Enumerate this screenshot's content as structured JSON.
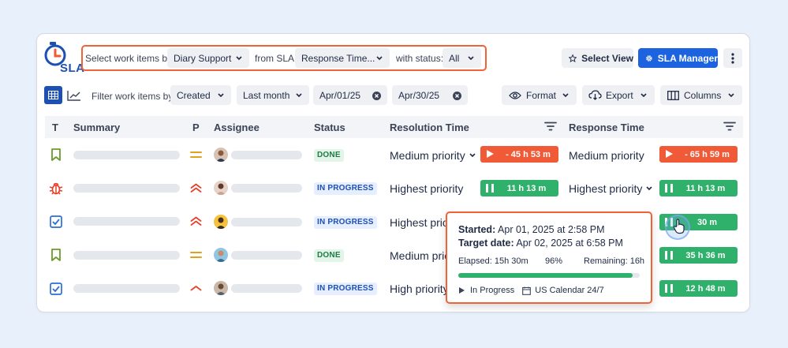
{
  "app": {
    "logo_text": "SLA"
  },
  "toolbar": {
    "select_label": "Select work items by:",
    "project_value": "Diary Support",
    "from_sla_label": "from SLA:",
    "sla_value": "Response Time...",
    "with_status_label": "with status:",
    "status_value": "All",
    "select_view_label": "Select View",
    "sla_manager_label": "SLA Manager"
  },
  "filters": {
    "label": "Filter work items by:",
    "field_value": "Created",
    "period_value": "Last month",
    "date_from": "Apr/01/25",
    "date_to": "Apr/30/25",
    "format_label": "Format",
    "export_label": "Export",
    "columns_label": "Columns"
  },
  "table": {
    "headers": {
      "type": "T",
      "summary": "Summary",
      "priority": "P",
      "assignee": "Assignee",
      "status": "Status",
      "resolution": "Resolution Time",
      "response": "Response Time"
    },
    "rows": [
      {
        "type_icon": "bookmark-icon",
        "status": "DONE",
        "resolution_priority": "Medium priority",
        "resolution_timer": "- 45 h 53 m",
        "response_priority": "Medium priority",
        "response_timer": "- 65 h 59 m"
      },
      {
        "type_icon": "bug-icon",
        "status": "IN PROGRESS",
        "resolution_priority": "Highest priority",
        "resolution_timer": "11 h 13 m",
        "response_priority": "Highest priority",
        "response_timer": "11 h 13 m"
      },
      {
        "type_icon": "checkbox-icon",
        "status": "IN PROGRESS",
        "resolution_priority": "Highest priori",
        "resolution_timer": "",
        "response_priority": "",
        "response_timer": "30 m"
      },
      {
        "type_icon": "bookmark-icon",
        "status": "DONE",
        "resolution_priority": "Medium prio",
        "resolution_timer": "",
        "response_priority": "",
        "response_timer": "35 h 36 m"
      },
      {
        "type_icon": "checkbox-icon",
        "status": "IN PROGRESS",
        "resolution_priority": "High priority",
        "resolution_timer": "",
        "response_priority": "",
        "response_timer": "12 h 48 m"
      }
    ]
  },
  "tooltip": {
    "started_label": "Started:",
    "started_value": "Apr 01, 2025 at 2:58 PM",
    "target_label": "Target date:",
    "target_value": "Apr 02, 2025 at 6:58 PM",
    "elapsed": "Elapsed: 15h 30m",
    "percent": "96%",
    "percent_value": 0.96,
    "remaining": "Remaining: 16h",
    "state": "In Progress",
    "calendar": "US Calendar 24/7"
  },
  "colors": {
    "accent": "#1d63e0",
    "highlight": "#f06238",
    "overdue": "#f05a36",
    "running": "#2fb06b"
  }
}
